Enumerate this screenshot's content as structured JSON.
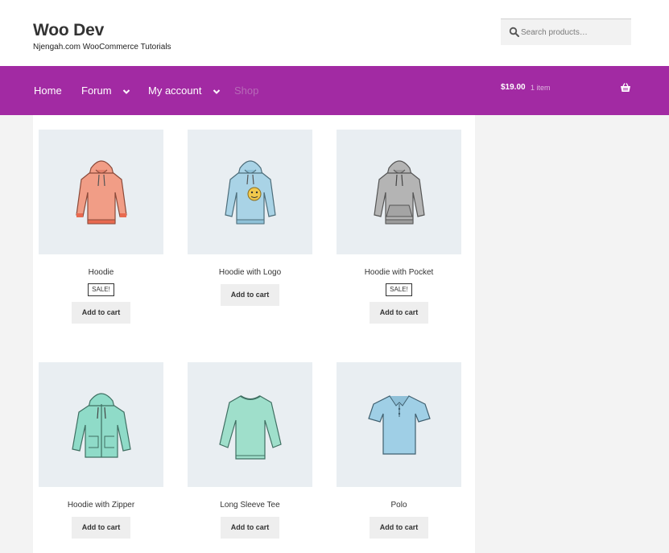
{
  "site": {
    "title": "Woo Dev",
    "tagline": "Njengah.com WooCommerce Tutorials"
  },
  "search": {
    "placeholder": "Search products…",
    "icon": "search-icon"
  },
  "nav": {
    "items": [
      {
        "label": "Home"
      },
      {
        "label": "Forum"
      },
      {
        "label": "My account"
      },
      {
        "label": "Shop"
      }
    ]
  },
  "cart": {
    "total": "$19.00",
    "count": "1 item",
    "icon": "basket-icon"
  },
  "products": [
    {
      "title": "Hoodie",
      "sale": "SALE!",
      "button": "Add to cart",
      "color": "#f19d86"
    },
    {
      "title": "Hoodie with Logo",
      "button": "Add to cart",
      "color": "#a9d3e6"
    },
    {
      "title": "Hoodie with Pocket",
      "sale": "SALE!",
      "button": "Add to cart",
      "color": "#b4b4b4"
    },
    {
      "title": "Hoodie with Zipper",
      "button": "Add to cart",
      "color": "#8fdbc8"
    },
    {
      "title": "Long Sleeve Tee",
      "button": "Add to cart",
      "color": "#9fdfcb"
    },
    {
      "title": "Polo",
      "button": "Add to cart",
      "color": "#9fcfe6"
    }
  ],
  "colors": {
    "nav_bg": "#a22aa3",
    "shop_link": "#b76ab8"
  }
}
